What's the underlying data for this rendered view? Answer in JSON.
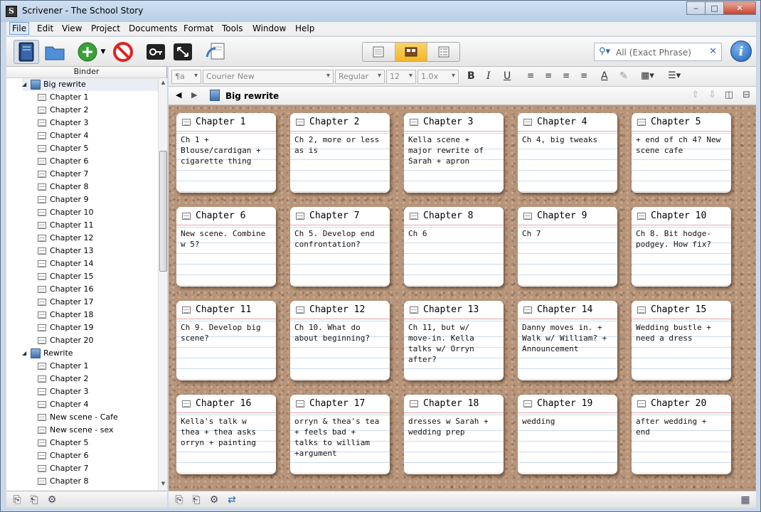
{
  "window": {
    "title": "Scrivener - The School Story",
    "minimize": "‒",
    "maximize": "□",
    "close": "✕"
  },
  "menu": [
    "File",
    "Edit",
    "View",
    "Project",
    "Documents",
    "Format",
    "Tools",
    "Window",
    "Help"
  ],
  "toolbar": {
    "icons": [
      "binder-toggle-icon",
      "collections-icon",
      "add-icon",
      "trash-icon",
      "compile-icon",
      "fullscreen-icon",
      "import-icon"
    ],
    "view_modes": [
      "scrivenings-icon",
      "corkboard-icon",
      "outliner-icon"
    ],
    "search_placeholder": "All (Exact Phrase)",
    "info": "i",
    "accent": "#f1b728"
  },
  "binder": {
    "header": "Binder",
    "rows": [
      {
        "label": "Big rewrite",
        "folder": true
      },
      {
        "label": "Chapter 1"
      },
      {
        "label": "Chapter 2"
      },
      {
        "label": "Chapter 3"
      },
      {
        "label": "Chapter 4"
      },
      {
        "label": "Chapter 5"
      },
      {
        "label": "Chapter 6"
      },
      {
        "label": "Chapter 7"
      },
      {
        "label": "Chapter 8"
      },
      {
        "label": "Chapter 9"
      },
      {
        "label": "Chapter 10"
      },
      {
        "label": "Chapter 11"
      },
      {
        "label": "Chapter 12"
      },
      {
        "label": "Chapter 13"
      },
      {
        "label": "Chapter 14"
      },
      {
        "label": "Chapter 15"
      },
      {
        "label": "Chapter 16"
      },
      {
        "label": "Chapter 17"
      },
      {
        "label": "Chapter 18"
      },
      {
        "label": "Chapter 19"
      },
      {
        "label": "Chapter 20"
      },
      {
        "label": "Rewrite",
        "folder": true
      },
      {
        "label": "Chapter 1"
      },
      {
        "label": "Chapter 2"
      },
      {
        "label": "Chapter 3"
      },
      {
        "label": "Chapter 4"
      },
      {
        "label": "New scene - Cafe"
      },
      {
        "label": "New scene - sex"
      },
      {
        "label": "Chapter 5"
      },
      {
        "label": "Chapter 6"
      },
      {
        "label": "Chapter 7"
      },
      {
        "label": "Chapter 8"
      }
    ]
  },
  "format": {
    "style": "¶a",
    "font": "Courier New",
    "weight": "Regular",
    "size": "12",
    "spacing": "1.0x"
  },
  "nav": {
    "title": "Big rewrite",
    "back": "◀",
    "forward": "▶"
  },
  "cards": [
    {
      "title": "Chapter 1",
      "synopsis": "Ch 1 +\nBlouse/cardigan +\ncigarette thing"
    },
    {
      "title": "Chapter 2",
      "synopsis": "Ch 2, more or less\nas is"
    },
    {
      "title": "Chapter 3",
      "synopsis": "Kella scene +\nmajor rewrite of\nSarah + apron"
    },
    {
      "title": "Chapter 4",
      "synopsis": "Ch 4, big tweaks"
    },
    {
      "title": "Chapter 5",
      "synopsis": "+ end of ch 4? New\nscene cafe"
    },
    {
      "title": "Chapter 6",
      "synopsis": "New scene. Combine\nw 5?"
    },
    {
      "title": "Chapter 7",
      "synopsis": "Ch 5. Develop end\nconfrontation?"
    },
    {
      "title": "Chapter 8",
      "synopsis": "Ch 6"
    },
    {
      "title": "Chapter 9",
      "synopsis": "Ch 7"
    },
    {
      "title": "Chapter 10",
      "synopsis": "Ch 8. Bit hodge-\npodgey. How fix?"
    },
    {
      "title": "Chapter 11",
      "synopsis": "Ch 9. Develop big\nscene?"
    },
    {
      "title": "Chapter 12",
      "synopsis": "Ch 10. What do\nabout beginning?"
    },
    {
      "title": "Chapter 13",
      "synopsis": "Ch 11, but w/\nmove-in. Kella\ntalks w/ Orryn\nafter?"
    },
    {
      "title": "Chapter 14",
      "synopsis": "Danny moves in. +\nWalk w/ William? +\nAnnouncement"
    },
    {
      "title": "Chapter 15",
      "synopsis": "Wedding bustle +\nneed a dress"
    },
    {
      "title": "Chapter 16",
      "synopsis": "Kella's talk w\nthea + thea asks\norryn + painting"
    },
    {
      "title": "Chapter 17",
      "synopsis": "orryn & thea's tea\n+ feels bad +\ntalks to william\n+argument"
    },
    {
      "title": "Chapter 18",
      "synopsis": "dresses w Sarah +\nwedding prep"
    },
    {
      "title": "Chapter 19",
      "synopsis": "wedding"
    },
    {
      "title": "Chapter 20",
      "synopsis": "after wedding +\nend"
    }
  ]
}
